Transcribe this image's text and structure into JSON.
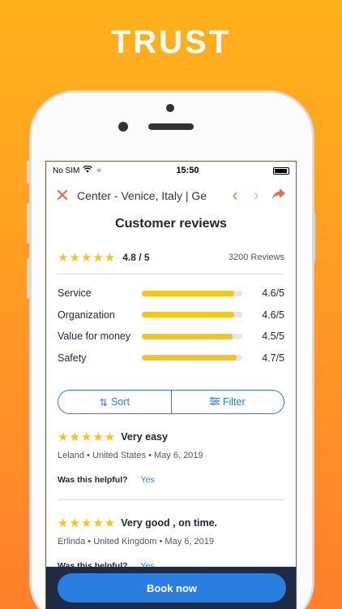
{
  "headline": "TRUST",
  "status": {
    "carrier": "No SIM",
    "time": "15:50"
  },
  "nav": {
    "title": "Center - Venice, Italy | Ge",
    "close_icon": "close-icon",
    "prev_icon": "chevron-left-icon",
    "next_icon": "chevron-right-icon",
    "share_icon": "share-icon"
  },
  "page_title": "Customer reviews",
  "summary": {
    "stars": "★★★★★",
    "rating": "4.8 / 5",
    "count": "3200 Reviews"
  },
  "categories": [
    {
      "label": "Service",
      "score": "4.6/5",
      "fraction": 0.92
    },
    {
      "label": "Organization",
      "score": "4.6/5",
      "fraction": 0.92
    },
    {
      "label": "Value for money",
      "score": "4.5/5",
      "fraction": 0.9
    },
    {
      "label": "Safety",
      "score": "4.7/5",
      "fraction": 0.94
    }
  ],
  "sort_label": "Sort",
  "filter_label": "Filter",
  "reviews": [
    {
      "stars": "★★★★★",
      "title": "Very easy",
      "meta": "Leland • United States • May 6, 2019",
      "helpful_q": "Was this helpful?",
      "helpful_yes": "Yes"
    },
    {
      "stars": "★★★★★",
      "title": "Very good , on time.",
      "meta": "Erlinda • United Kingdom • May 6, 2019",
      "helpful_q": "Was this helpful?",
      "helpful_yes": "Yes"
    }
  ],
  "book_label": "Book now",
  "colors": {
    "accent": "#2a7de1",
    "star": "#f5c518",
    "nav_icon": "#e5734a",
    "bottom_bar": "#1f2a44"
  }
}
